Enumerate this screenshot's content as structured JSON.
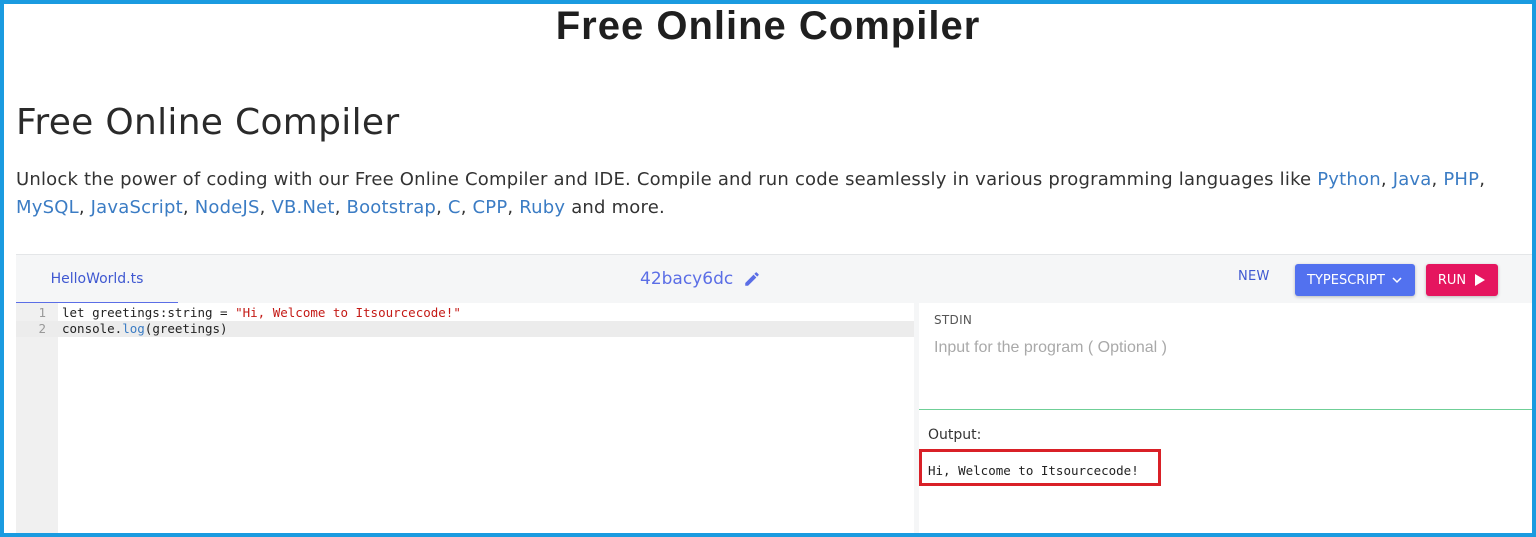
{
  "banner": {
    "title": "Free Online Compiler"
  },
  "page": {
    "heading": "Free Online Compiler",
    "intro_text": "Unlock the power of coding with our Free Online Compiler and IDE. Compile and run code seamlessly in various programming languages like",
    "languages": [
      "Python",
      "Java",
      "PHP",
      "MySQL",
      "JavaScript",
      "NodeJS",
      "VB.Net",
      "Bootstrap",
      "C",
      "CPP",
      "Ruby"
    ],
    "intro_suffix": "and more."
  },
  "ide": {
    "file_tab": "HelloWorld.ts",
    "session_id": "42bacy6dc",
    "new_label": "NEW",
    "language_label": "TYPESCRIPT",
    "run_label": "RUN",
    "code": {
      "line_numbers": [
        "1",
        "2"
      ],
      "line1_prefix": "let greetings:string = ",
      "line1_string": "\"Hi, Welcome to Itsourcecode!\"",
      "line2_obj": "console.",
      "line2_method": "log",
      "line2_args": "(greetings)"
    },
    "stdin_label": "STDIN",
    "stdin_placeholder": "Input for the program ( Optional )",
    "output_label": "Output:",
    "output_text": "Hi, Welcome to Itsourcecode!",
    "colors": {
      "accent": "#5271ef",
      "run": "#e5155f",
      "highlight_box": "#d92027",
      "link": "#3b7cc4"
    }
  }
}
